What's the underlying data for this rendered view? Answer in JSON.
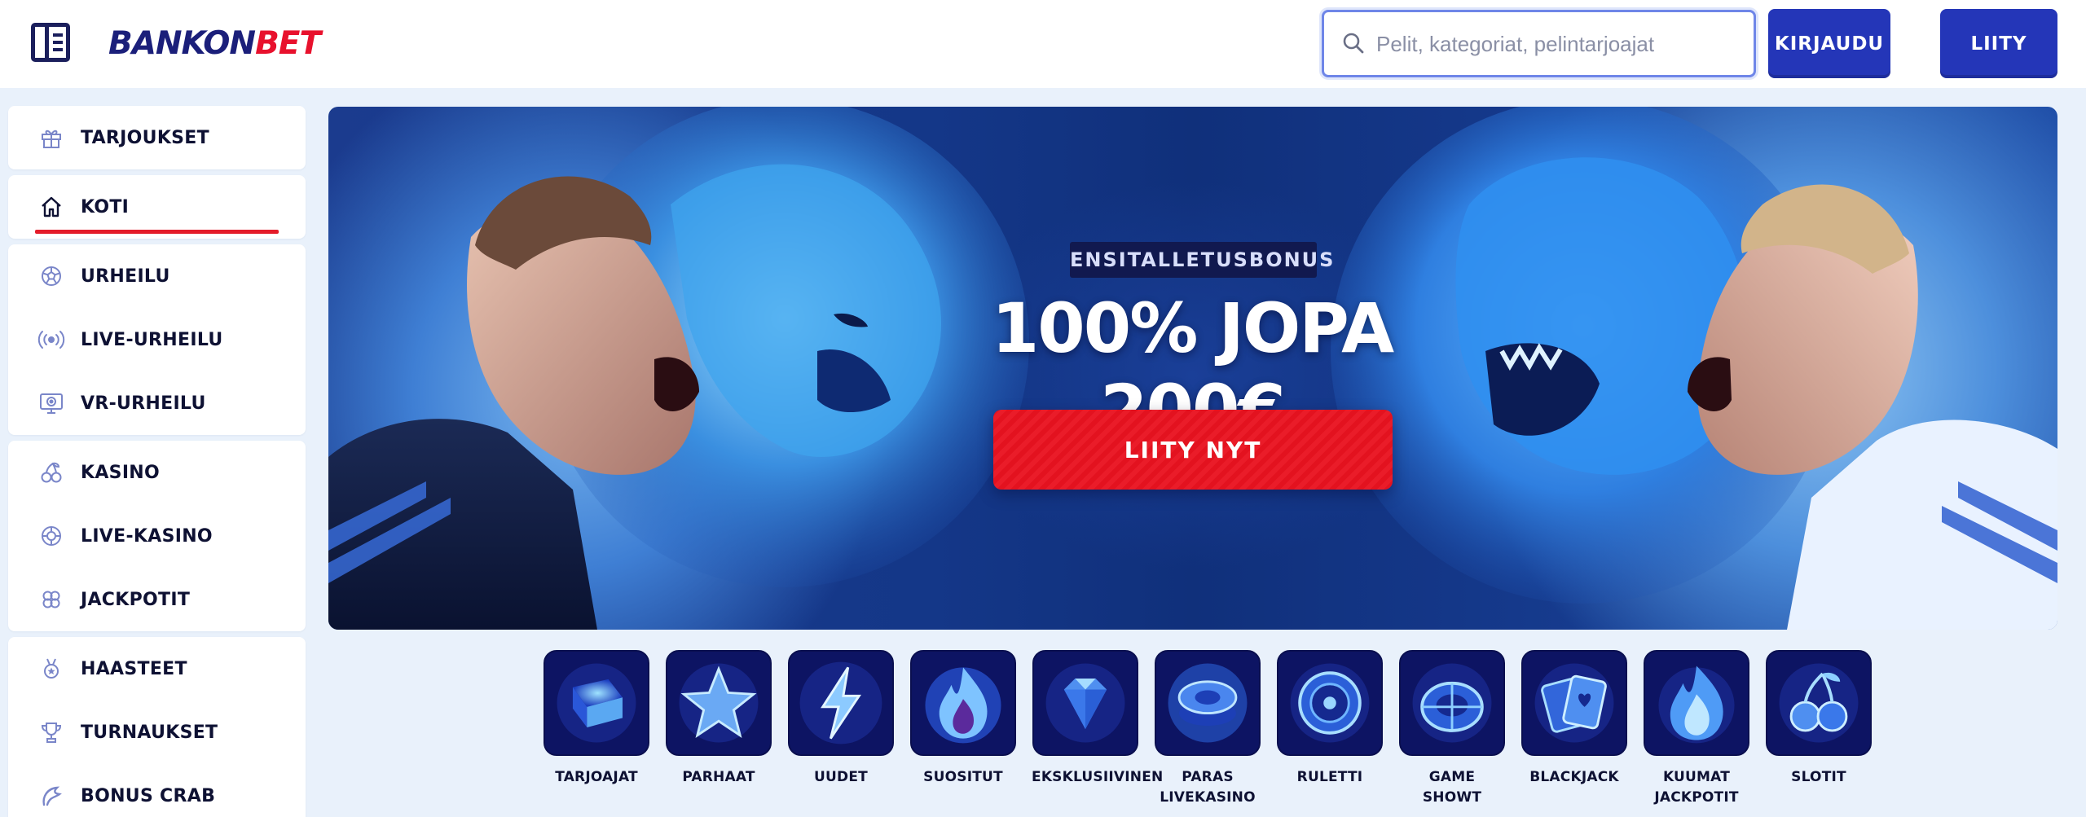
{
  "brand": {
    "part1": "BANKON",
    "part2": "BET"
  },
  "header": {
    "search_placeholder": "Pelit, kategoriat, pelintarjoajat",
    "login_label": "KIRJAUDU",
    "join_label": "LIITY"
  },
  "sidebar": {
    "groups": [
      [
        {
          "label": "TARJOUKSET",
          "icon": "gift-icon"
        }
      ],
      [
        {
          "label": "KOTI",
          "icon": "home-icon",
          "active": true
        }
      ],
      [
        {
          "label": "URHEILU",
          "icon": "football-icon"
        },
        {
          "label": "LIVE-URHEILU",
          "icon": "broadcast-icon"
        },
        {
          "label": "VR-URHEILU",
          "icon": "vr-monitor-icon"
        }
      ],
      [
        {
          "label": "KASINO",
          "icon": "cherries-icon"
        },
        {
          "label": "LIVE-KASINO",
          "icon": "chip-icon"
        },
        {
          "label": "JACKPOTIT",
          "icon": "clover-icon"
        }
      ],
      [
        {
          "label": "HAASTEET",
          "icon": "medal-icon"
        },
        {
          "label": "TURNAUKSET",
          "icon": "trophy-icon"
        },
        {
          "label": "BONUS CRAB",
          "icon": "crab-claw-icon"
        }
      ]
    ]
  },
  "hero": {
    "badge": "ENSITALLETUSBONUS",
    "headline": "100% JOPA 200€",
    "cta_label": "LIITY NYT"
  },
  "categories": [
    {
      "label": "TARJOAJAT",
      "icon": "book-icon"
    },
    {
      "label": "PARHAAT",
      "icon": "star-icon"
    },
    {
      "label": "UUDET",
      "icon": "lightning-icon"
    },
    {
      "label": "SUOSITUT",
      "icon": "flame-icon"
    },
    {
      "label": "EKSKLUSIIVINEN",
      "icon": "diamond-icon"
    },
    {
      "label": "PARAS LIVEKASINO",
      "icon": "poker-chip-icon"
    },
    {
      "label": "RULETTI",
      "icon": "roulette-icon"
    },
    {
      "label": "GAME SHOWT",
      "icon": "wheel-icon"
    },
    {
      "label": "BLACKJACK",
      "icon": "cards-icon"
    },
    {
      "label": "KUUMAT JACKPOTIT",
      "icon": "hot-flame-icon"
    },
    {
      "label": "SLOTIT",
      "icon": "cherry-icon"
    }
  ],
  "colors": {
    "brand_navy": "#1b1f7a",
    "brand_red": "#e8112d",
    "button_blue": "#2436b8",
    "cta_red": "#e3121f",
    "tile_navy": "#0d1463"
  }
}
